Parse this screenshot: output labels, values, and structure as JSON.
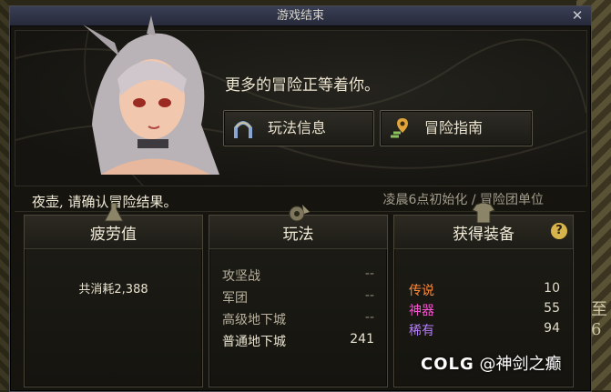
{
  "window": {
    "title": "游戏结束",
    "close_glyph": "✕"
  },
  "header": {
    "headline": "更多的冒险正等着你。"
  },
  "buttons": {
    "rules_label": "玩法信息",
    "guide_label": "冒险指南"
  },
  "greeting": "夜壶,   请确认冒险结果。",
  "reset_note": "凌晨6点初始化 / 冒险团单位",
  "fatigue": {
    "title": "疲劳值",
    "text": "共消耗2,388"
  },
  "play": {
    "title": "玩法",
    "rows": [
      {
        "name": "攻坚战",
        "value": "--"
      },
      {
        "name": "军团",
        "value": "--"
      },
      {
        "name": "高级地下城",
        "value": "--"
      },
      {
        "name": "普通地下城",
        "value": "241"
      }
    ]
  },
  "loot": {
    "title": "获得装备",
    "help_glyph": "?",
    "rows": [
      {
        "name": "传说",
        "value": "10",
        "color": "#ff8a3a"
      },
      {
        "name": "神器",
        "value": "55",
        "color": "#ff4fd6"
      },
      {
        "name": "稀有",
        "value": "94",
        "color": "#b77dff"
      }
    ]
  },
  "watermark": {
    "brand": "COLG",
    "text": "@神剑之癫"
  },
  "icons": {
    "rules": "arch-gate-icon",
    "guide": "map-pin-icon",
    "fatigue": "flask-icon",
    "play": "gear-axe-icon",
    "loot": "armor-icon"
  }
}
